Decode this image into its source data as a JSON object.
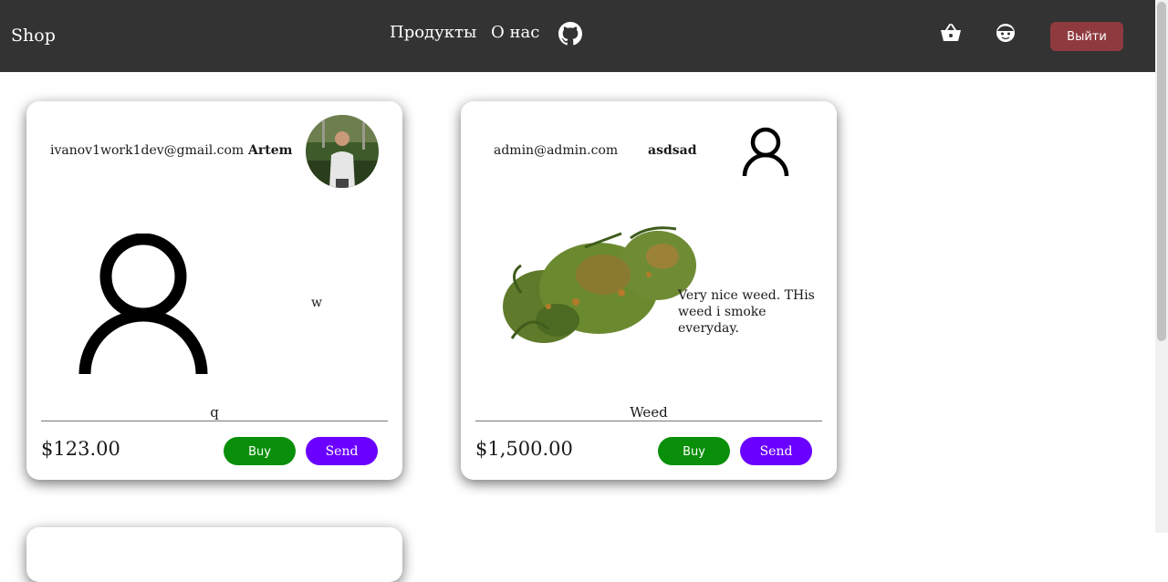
{
  "navbar": {
    "brand": "Shop",
    "links": [
      "Продукты",
      "О нас"
    ],
    "logout_label": "Выйти",
    "background": "#333333",
    "logout_color": "#8f3a3f"
  },
  "products": [
    {
      "email": "ivanov1work1dev@gmail.com",
      "username": "Artem",
      "avatar": "user-photo",
      "image": "person-icon",
      "description": "w",
      "name": "q",
      "price": "$123.00",
      "buy_label": "Buy",
      "send_label": "Send"
    },
    {
      "email": "admin@admin.com",
      "username": "asdsad",
      "avatar": "person-icon",
      "image": "weed-photo",
      "description": "Very nice weed. THis weed i smoke everyday.",
      "name": "Weed",
      "price": "$1,500.00",
      "buy_label": "Buy",
      "send_label": "Send"
    }
  ],
  "colors": {
    "buy": "#0a8f0a",
    "send": "#6a00ff"
  }
}
